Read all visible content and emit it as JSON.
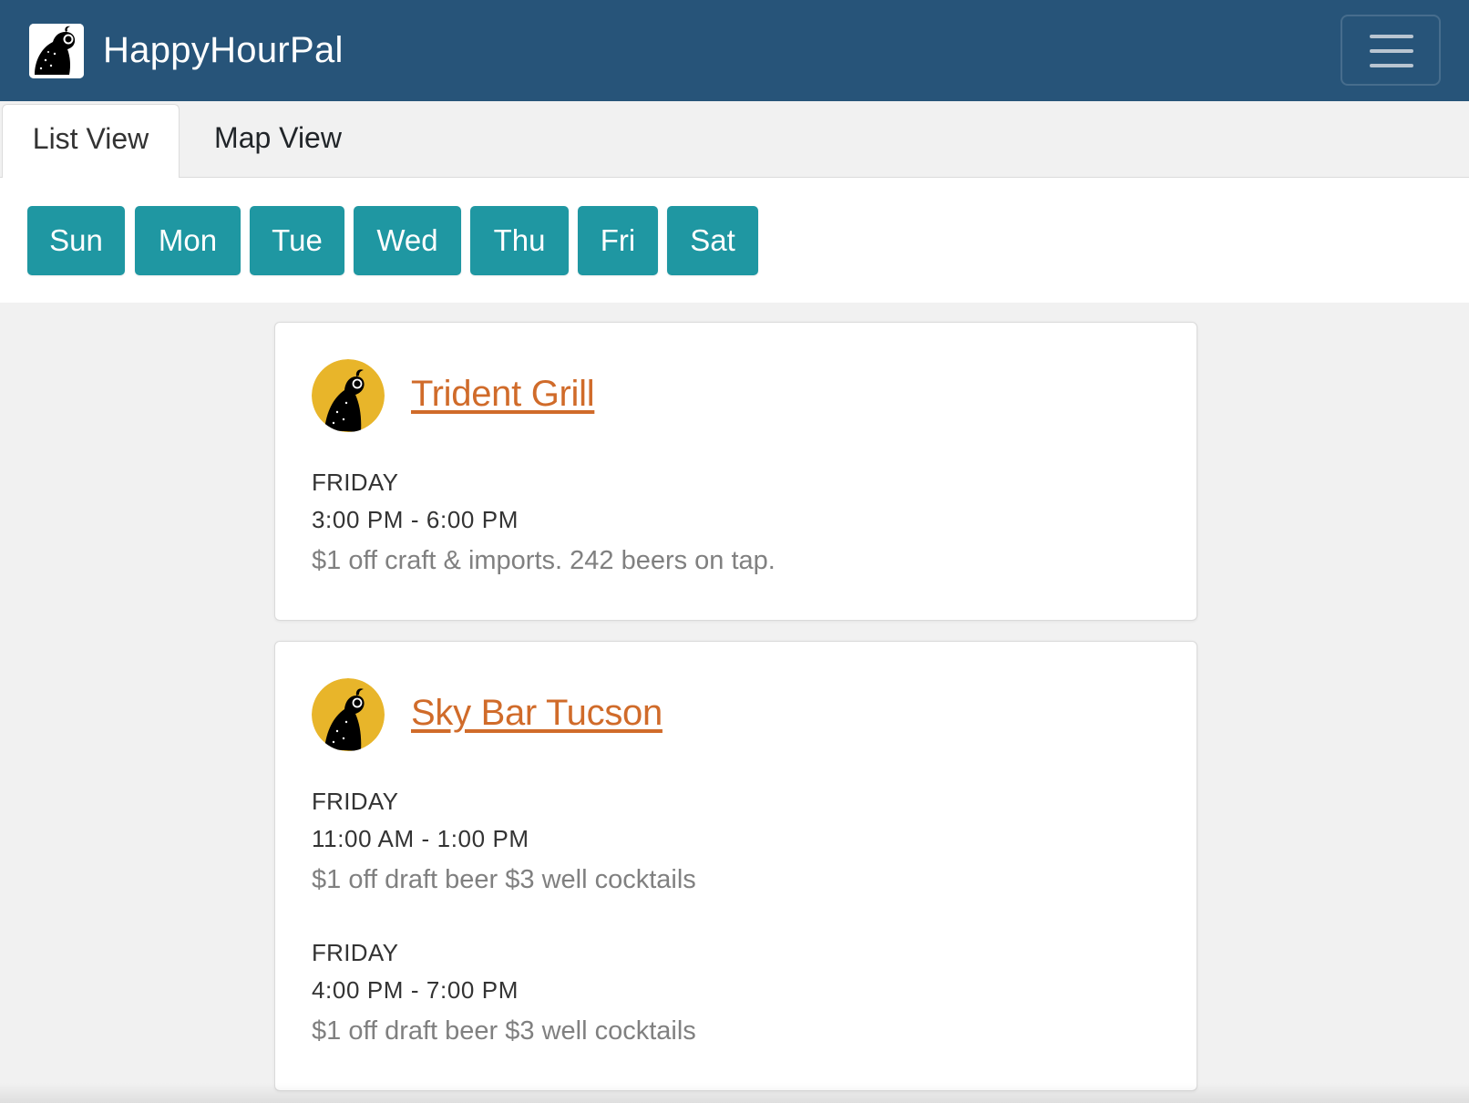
{
  "app": {
    "name": "HappyHourPal",
    "logo_icon": "quail-logo-icon",
    "menu_icon": "hamburger-menu-icon"
  },
  "tabs": [
    {
      "label": "List View",
      "active": true
    },
    {
      "label": "Map View",
      "active": false
    }
  ],
  "days": [
    "Sun",
    "Mon",
    "Tue",
    "Wed",
    "Thu",
    "Fri",
    "Sat"
  ],
  "venues": [
    {
      "name": "Trident Grill",
      "deals": [
        {
          "day": "FRIDAY",
          "time": "3:00 PM - 6:00 PM",
          "description": "$1 off craft & imports. 242 beers on tap."
        }
      ]
    },
    {
      "name": "Sky Bar Tucson",
      "deals": [
        {
          "day": "FRIDAY",
          "time": "11:00 AM - 1:00 PM",
          "description": "$1 off draft beer $3 well cocktails"
        },
        {
          "day": "FRIDAY",
          "time": "4:00 PM - 7:00 PM",
          "description": "$1 off draft beer $3 well cocktails"
        }
      ]
    }
  ],
  "colors": {
    "navbar": "#275479",
    "day_button": "#1f97a2",
    "venue_link": "#d06b2a",
    "avatar_bg": "#e8b52a"
  }
}
